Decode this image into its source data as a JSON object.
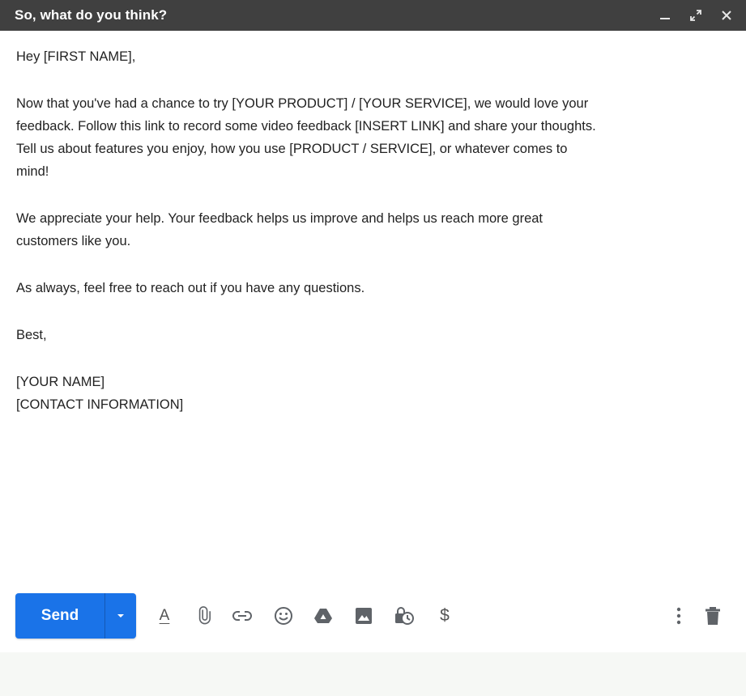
{
  "window": {
    "title": "So, what do you think?",
    "controls": {
      "minimize": "minimize-icon",
      "expand": "expand-icon",
      "close": "close-icon"
    }
  },
  "email": {
    "greeting": "Hey [FIRST NAME],",
    "paragraph1_line1": "Now that you've had a chance to try [YOUR PRODUCT] / [YOUR SERVICE], we would love your",
    "paragraph1_line2": "feedback. Follow this link to record some video feedback [INSERT LINK] and share your thoughts.",
    "paragraph1_line3": "Tell us about features you enjoy, how you use [PRODUCT / SERVICE], or whatever comes to",
    "paragraph1_line4": "mind!",
    "paragraph2_line1": "We appreciate your help. Your feedback helps us improve and helps us reach more great",
    "paragraph2_line2": "customers like you.",
    "paragraph3": "As always, feel free to reach out if you have any questions.",
    "signoff": "Best,",
    "name": "[YOUR NAME]",
    "contact": "[CONTACT INFORMATION]"
  },
  "toolbar": {
    "send_label": "Send",
    "format_label": "A",
    "dollar_label": "$",
    "icons": [
      "send-options-icon",
      "format-text-icon",
      "attach-icon",
      "link-icon",
      "emoji-icon",
      "drive-icon",
      "photo-icon",
      "confidential-icon",
      "money-icon",
      "more-options-icon",
      "delete-icon"
    ]
  },
  "colors": {
    "titlebar": "#404040",
    "send_button": "#1a73e8",
    "icon": "#5f6368",
    "text": "#222222"
  }
}
